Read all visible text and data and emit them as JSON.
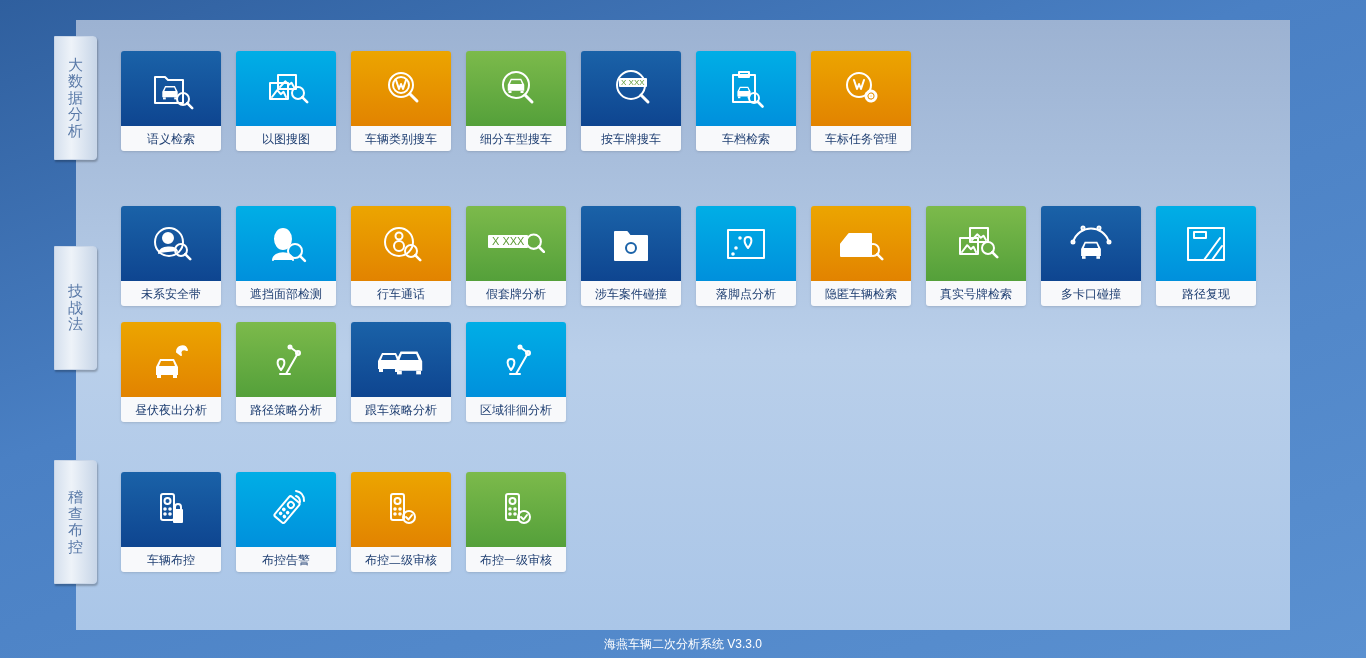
{
  "sections": [
    {
      "label": "大数据分析",
      "tiles": [
        {
          "label": "语义检索",
          "color": "#1a62a8"
        },
        {
          "label": "以图搜图",
          "color": "#00aee6"
        },
        {
          "label": "车辆类别搜车",
          "color": "#eca500"
        },
        {
          "label": "细分车型搜车",
          "color": "#7cba4b"
        },
        {
          "label": "按车牌搜车",
          "color": "#1a62a8",
          "icon_text": "X XXX"
        },
        {
          "label": "车档检索",
          "color": "#00aee6"
        },
        {
          "label": "车标任务管理",
          "color": "#eca500"
        }
      ]
    },
    {
      "label": "技战法",
      "tiles": [
        {
          "label": "未系安全带",
          "color": "#1a62a8"
        },
        {
          "label": "遮挡面部检测",
          "color": "#00aee6"
        },
        {
          "label": "行车通话",
          "color": "#eca500"
        },
        {
          "label": "假套牌分析",
          "color": "#7cba4b",
          "icon_text": "X XXX"
        },
        {
          "label": "涉车案件碰撞",
          "color": "#1a62a8"
        },
        {
          "label": "落脚点分析",
          "color": "#00aee6"
        },
        {
          "label": "隐匿车辆检索",
          "color": "#eca500"
        },
        {
          "label": "真实号牌检索",
          "color": "#7cba4b"
        },
        {
          "label": "多卡口碰撞",
          "color": "#1a62a8"
        },
        {
          "label": "路径复现",
          "color": "#00aee6"
        },
        {
          "label": "昼伏夜出分析",
          "color": "#eca500"
        },
        {
          "label": "路径策略分析",
          "color": "#7cba4b"
        },
        {
          "label": "跟车策略分析",
          "color": "#1a62a8"
        },
        {
          "label": "区域徘徊分析",
          "color": "#00aee6"
        }
      ]
    },
    {
      "label": "稽查布控",
      "tiles": [
        {
          "label": "车辆布控",
          "color": "#1a62a8"
        },
        {
          "label": "布控告警",
          "color": "#00aee6"
        },
        {
          "label": "布控二级审核",
          "color": "#eca500"
        },
        {
          "label": "布控一级审核",
          "color": "#7cba4b"
        }
      ]
    }
  ],
  "footer": "海燕车辆二次分析系统 V3.3.0"
}
